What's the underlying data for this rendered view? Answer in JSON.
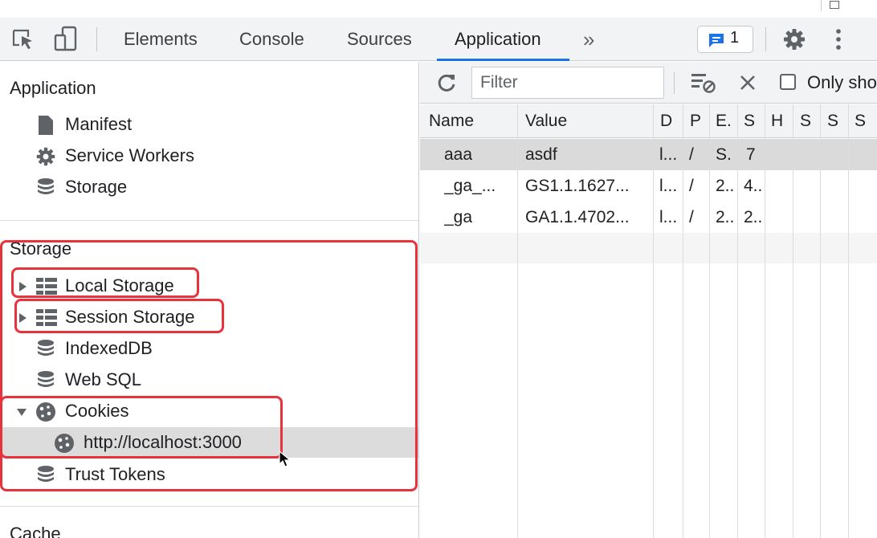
{
  "toolbar": {
    "tabs": [
      {
        "label": "Elements"
      },
      {
        "label": "Console"
      },
      {
        "label": "Sources"
      },
      {
        "label": "Application",
        "active": true
      }
    ],
    "more_tabs": "»",
    "issues_count": "1"
  },
  "sidebar": {
    "application_title": "Application",
    "application_items": [
      "Manifest",
      "Service Workers",
      "Storage"
    ],
    "storage_title": "Storage",
    "storage_items": [
      "Local Storage",
      "Session Storage",
      "IndexedDB",
      "Web SQL",
      "Cookies",
      "http://localhost:3000",
      "Trust Tokens"
    ],
    "cache_title": "Cache"
  },
  "cookies": {
    "filter_placeholder": "Filter",
    "only_show_label": "Only show",
    "columns": [
      "Name",
      "Value",
      "D",
      "P",
      "E.",
      "S",
      "H",
      "S",
      "S",
      "S"
    ],
    "rows": [
      {
        "name": "aaa",
        "value": "asdf",
        "domain": "l...",
        "path": "/",
        "expires": "S.",
        "size": "7",
        "selected": true
      },
      {
        "name": "_ga_...",
        "value": "GS1.1.1627...",
        "domain": "l...",
        "path": "/",
        "expires": "2..",
        "size": "4.."
      },
      {
        "name": "_ga",
        "value": "GA1.1.4702...",
        "domain": "l...",
        "path": "/",
        "expires": "2..",
        "size": "2.."
      }
    ]
  },
  "colors": {
    "accent": "#1a73e8",
    "highlight": "#e8323c",
    "toolbar_bg": "#f1f3f4"
  }
}
